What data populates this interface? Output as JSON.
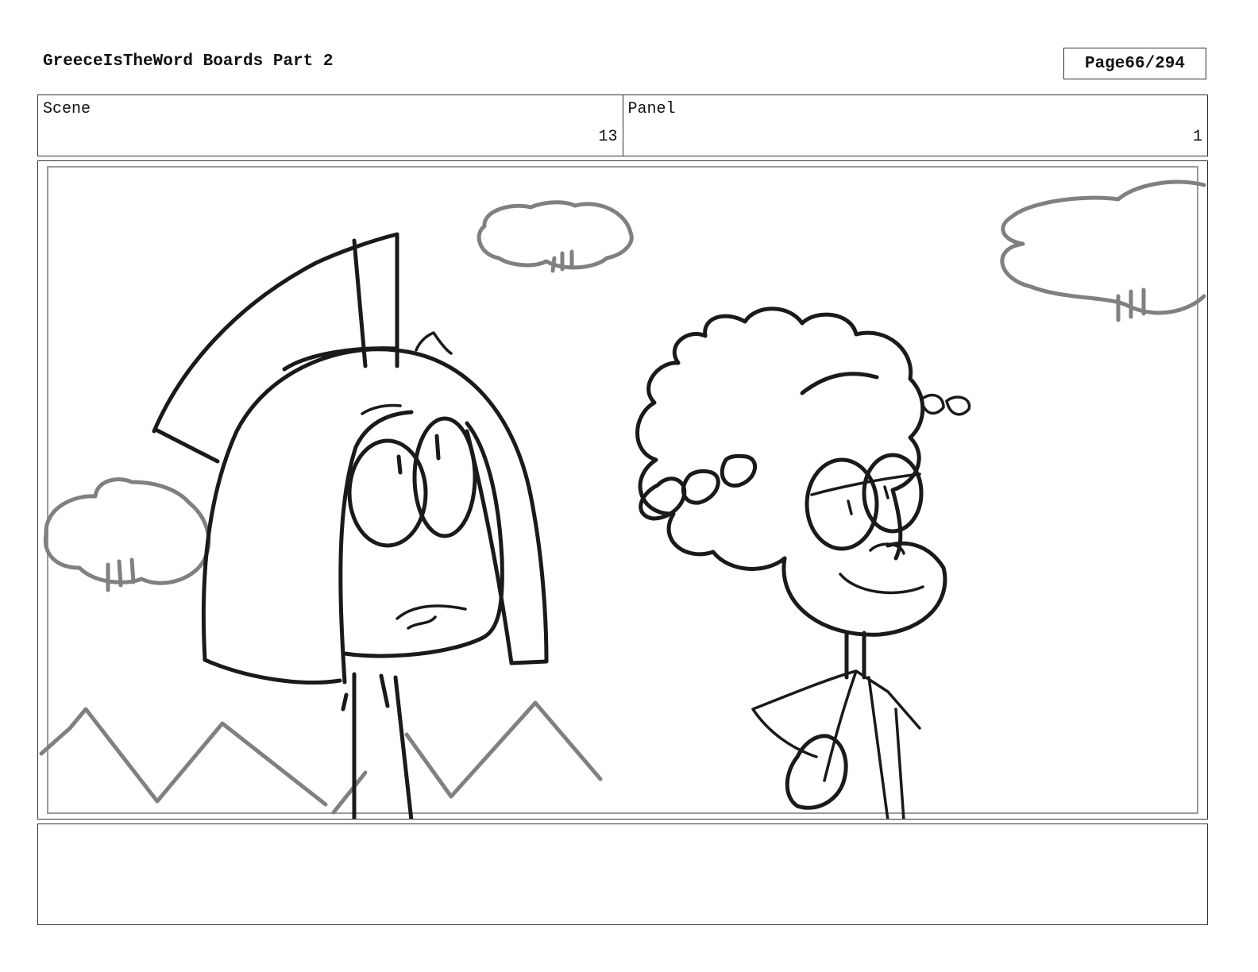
{
  "header": {
    "title": "GreeceIsTheWord Boards Part 2",
    "page_label": "Page",
    "page_number": "66/294"
  },
  "scene": {
    "label": "Scene",
    "value": "13"
  },
  "panel": {
    "label": "Panel",
    "value": "1"
  },
  "notes": {
    "text": ""
  },
  "drawing": {
    "content": "storyboard-sketch",
    "ink_color": "#1a1a1a",
    "background_ink_color": "#808080"
  }
}
